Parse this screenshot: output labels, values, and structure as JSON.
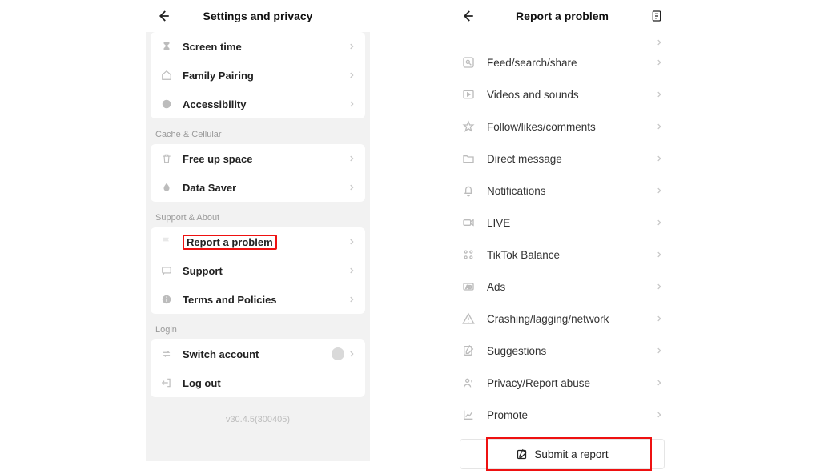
{
  "left": {
    "title": "Settings and privacy",
    "group1": {
      "items": [
        {
          "label": "Screen time"
        },
        {
          "label": "Family Pairing"
        },
        {
          "label": "Accessibility"
        }
      ]
    },
    "group2": {
      "header": "Cache & Cellular",
      "items": [
        {
          "label": "Free up space"
        },
        {
          "label": "Data Saver"
        }
      ]
    },
    "group3": {
      "header": "Support & About",
      "items": [
        {
          "label": "Report a problem"
        },
        {
          "label": "Support"
        },
        {
          "label": "Terms and Policies"
        }
      ]
    },
    "group4": {
      "header": "Login",
      "items": [
        {
          "label": "Switch account"
        },
        {
          "label": "Log out"
        }
      ]
    },
    "version": "v30.4.5(300405)"
  },
  "right": {
    "title": "Report a problem",
    "items": [
      {
        "label": "Feed/search/share"
      },
      {
        "label": "Videos and sounds"
      },
      {
        "label": "Follow/likes/comments"
      },
      {
        "label": "Direct message"
      },
      {
        "label": "Notifications"
      },
      {
        "label": "LIVE"
      },
      {
        "label": "TikTok Balance"
      },
      {
        "label": "Ads"
      },
      {
        "label": "Crashing/lagging/network"
      },
      {
        "label": "Suggestions"
      },
      {
        "label": "Privacy/Report abuse"
      },
      {
        "label": "Promote"
      }
    ],
    "submit": "Submit a report"
  }
}
